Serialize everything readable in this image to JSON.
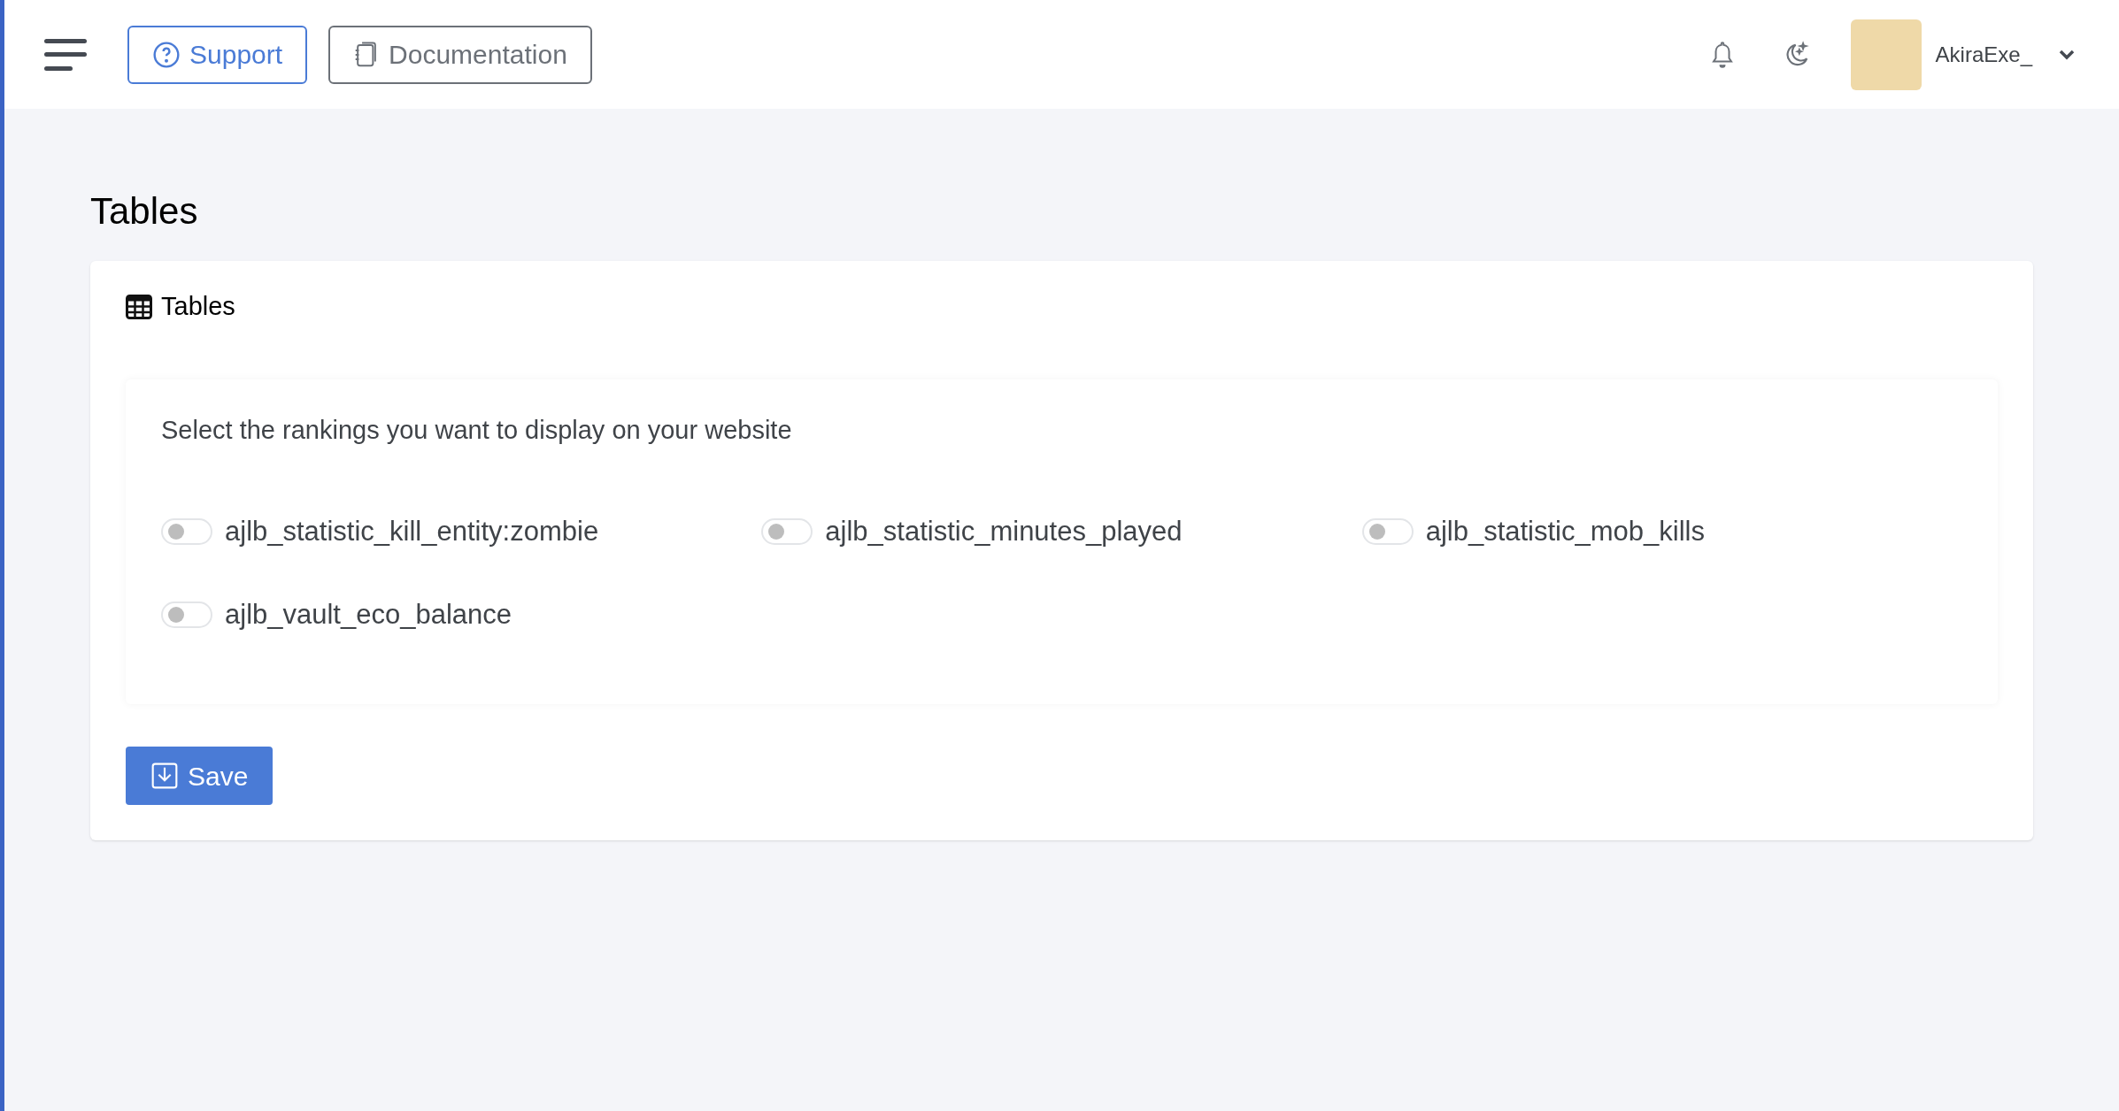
{
  "header": {
    "support_button": "Support",
    "documentation_button": "Documentation",
    "username": "AkiraExe_"
  },
  "page_title": "Tables",
  "card": {
    "title": "Tables",
    "instruction": "Select the rankings you want to display on your website",
    "rankings": [
      {
        "label": "ajlb_statistic_kill_entity:zombie",
        "on": false
      },
      {
        "label": "ajlb_statistic_minutes_played",
        "on": false
      },
      {
        "label": "ajlb_statistic_mob_kills",
        "on": false
      },
      {
        "label": "ajlb_vault_eco_balance",
        "on": false
      }
    ],
    "save_button": "Save"
  }
}
